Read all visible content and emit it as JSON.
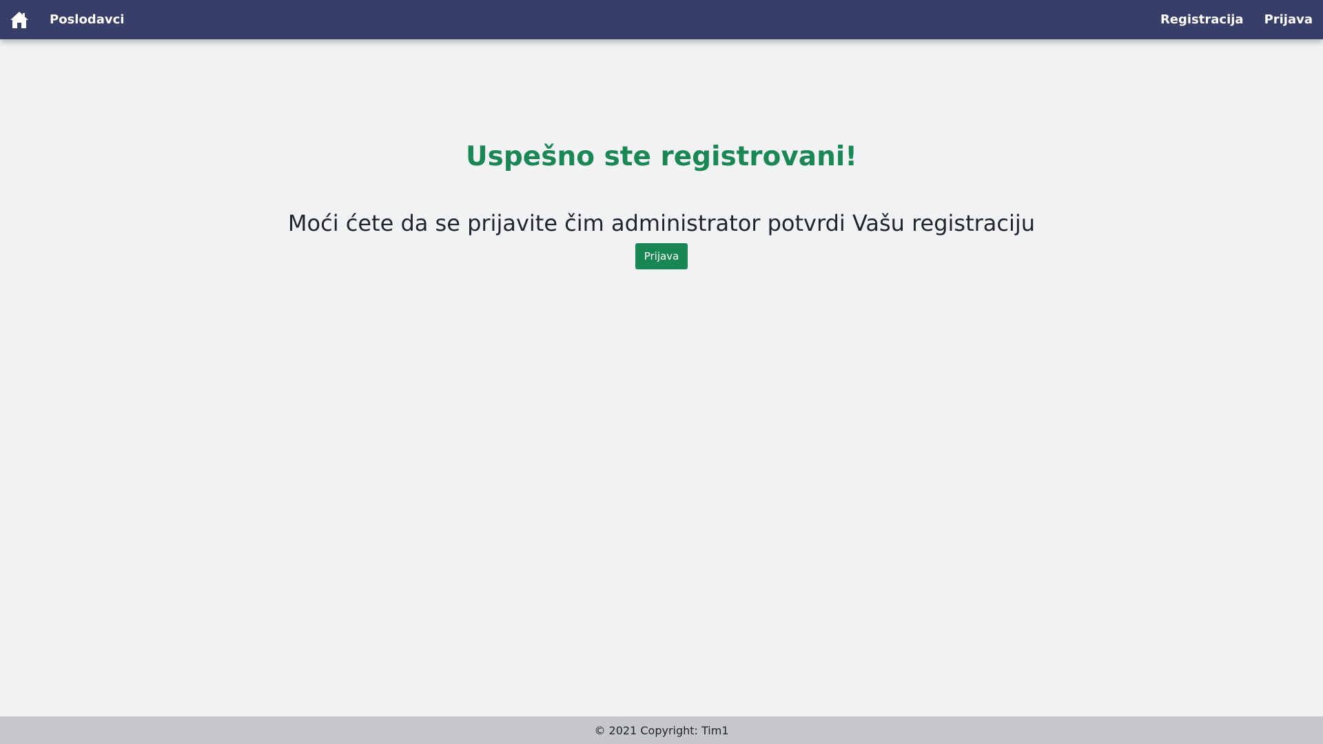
{
  "navbar": {
    "home_icon": "home-icon",
    "brand": "Poslodavci",
    "links": {
      "register": "Registracija",
      "login": "Prijava"
    }
  },
  "main": {
    "title": "Uspešno ste registrovani!",
    "message": "Moći ćete da se prijavite čim administrator potvrdi Vašu registraciju",
    "login_button": "Prijava"
  },
  "footer": {
    "text": "© 2021 Copyright: Tim1"
  },
  "colors": {
    "navbar": "#373f68",
    "success": "#198754",
    "background": "#f0f2f4",
    "footer": "#c5c7ca"
  }
}
